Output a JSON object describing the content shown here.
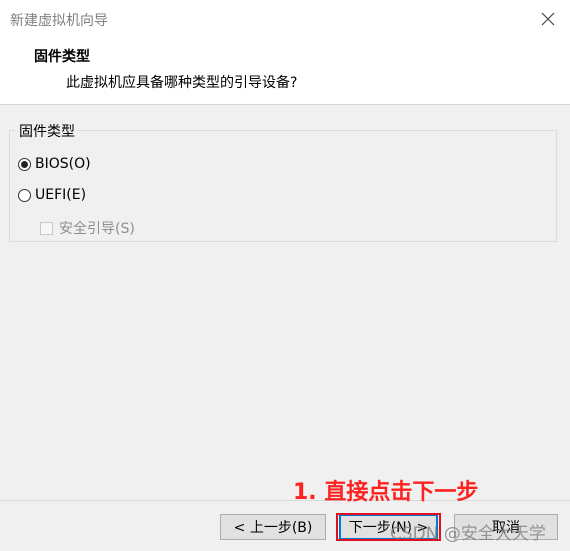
{
  "window": {
    "title": "新建虚拟机向导"
  },
  "header": {
    "title": "固件类型",
    "subtitle": "此虚拟机应具备哪种类型的引导设备?"
  },
  "firmware_group": {
    "legend": "固件类型",
    "options": [
      {
        "label": "BIOS(O)",
        "checked": true
      },
      {
        "label": "UEFI(E)",
        "checked": false
      }
    ],
    "secure_boot": {
      "label": "安全引导(S)",
      "checked": false,
      "enabled": false
    }
  },
  "footer": {
    "back_label": "< 上一步(B)",
    "next_label": "下一步(N) >",
    "cancel_label": "取消"
  },
  "annotation": {
    "text": "1. 直接点击下一步",
    "color": "#ff2020"
  },
  "watermark": {
    "text": "CSDN @安全大天学"
  },
  "colors": {
    "accent": "#0078d7",
    "highlight": "#e0101d"
  }
}
